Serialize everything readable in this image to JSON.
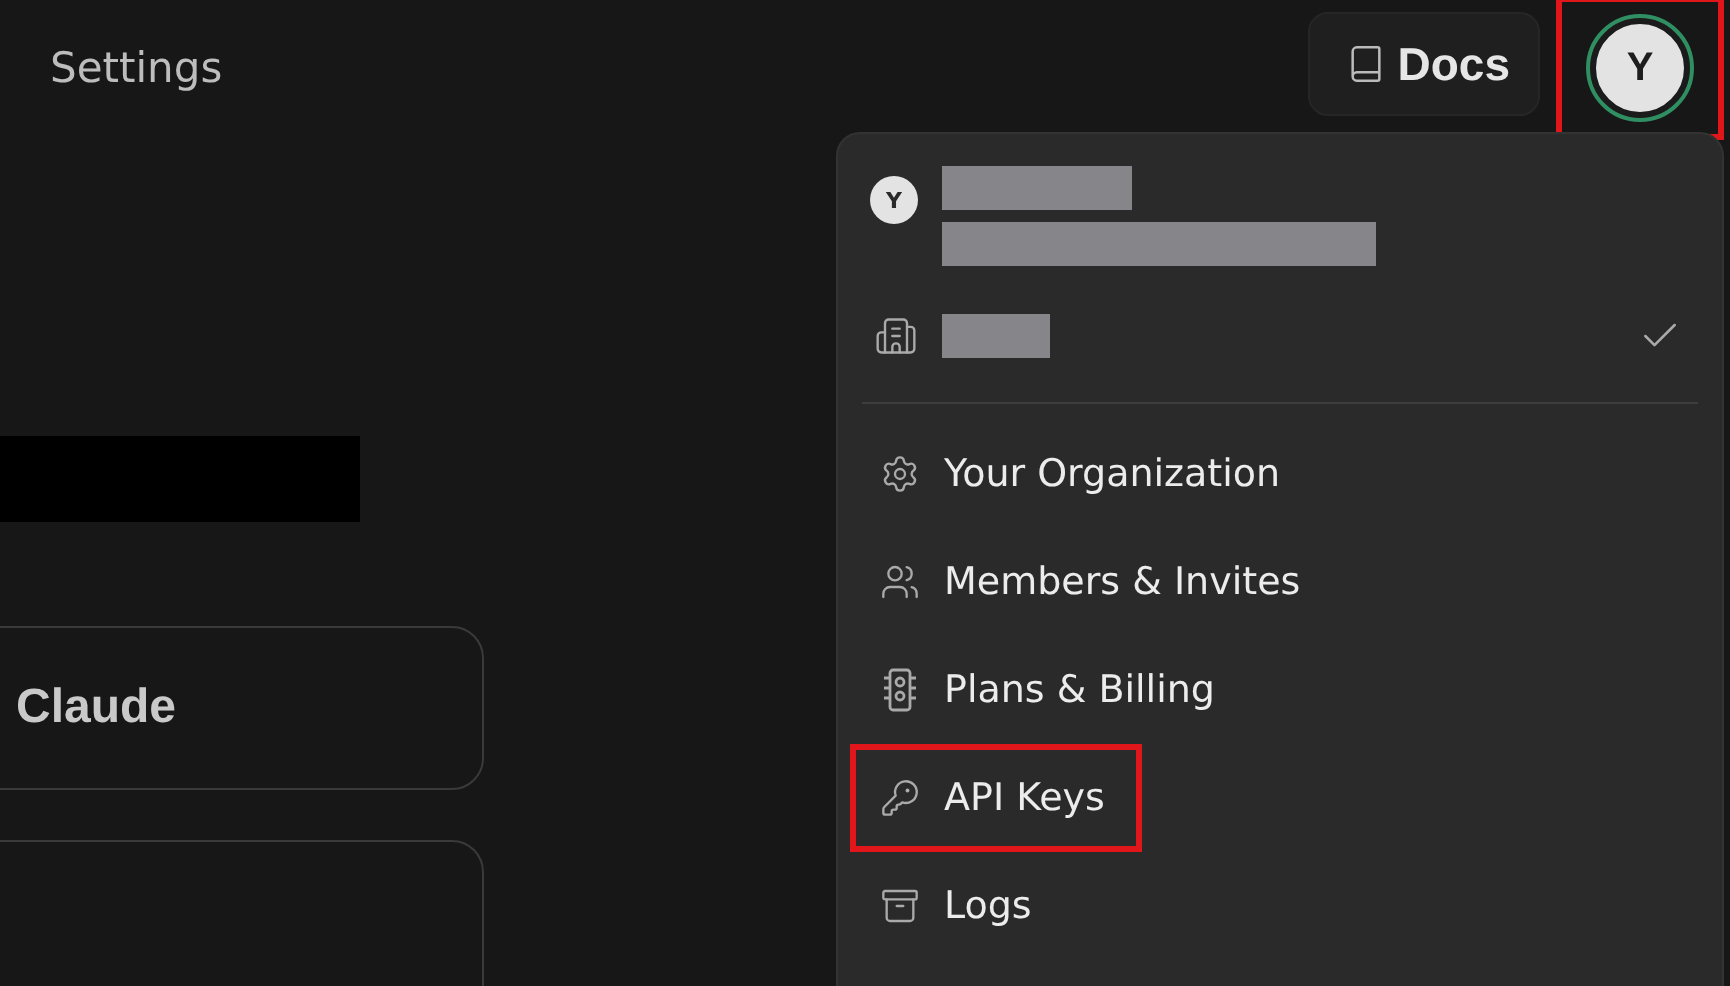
{
  "header": {
    "title": "Settings",
    "docs_button": "Docs",
    "avatar": {
      "initial": "Y",
      "highlighted": true
    }
  },
  "content": {
    "cards": [
      {
        "title": "Claude"
      }
    ]
  },
  "menu": {
    "user": {
      "initial": "Y"
    },
    "organization": {
      "selected": true
    },
    "items": [
      {
        "label": "Your Organization",
        "highlighted": false
      },
      {
        "label": "Members & Invites",
        "highlighted": false
      },
      {
        "label": "Plans & Billing",
        "highlighted": false
      },
      {
        "label": "API Keys",
        "highlighted": true
      },
      {
        "label": "Logs",
        "highlighted": false
      }
    ]
  }
}
